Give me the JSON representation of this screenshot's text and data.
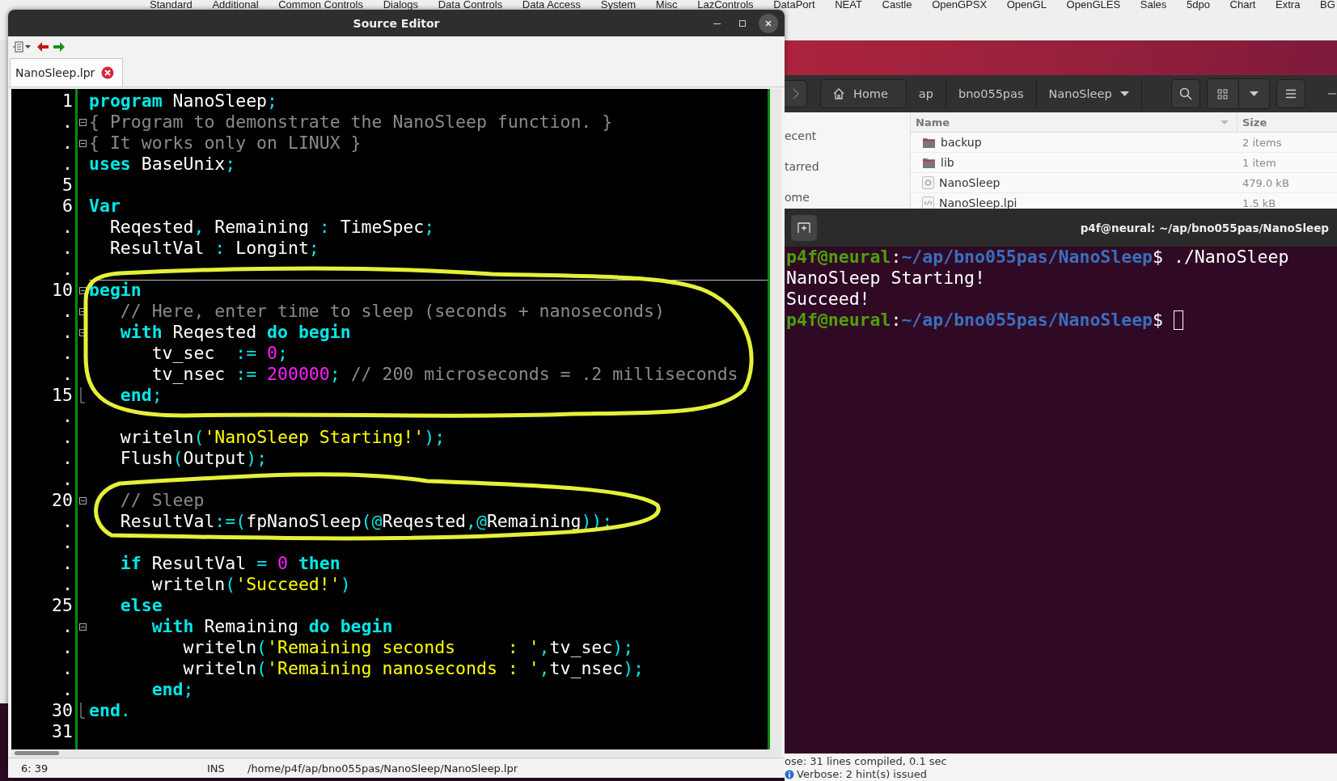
{
  "palette_tabs": [
    "Standard",
    "Additional",
    "Common Controls",
    "Dialogs",
    "Data Controls",
    "Data Access",
    "System",
    "Misc",
    "LazControls",
    "DataPort",
    "NEAT",
    "Castle",
    "OpenGPSX",
    "OpenGL",
    "OpenGLES",
    "Sales",
    "5dpo",
    "Chart",
    "Extra",
    "BG"
  ],
  "source_editor": {
    "title": "Source Editor",
    "tabs": [
      {
        "label": "NanoSleep.lpr",
        "selected": true
      }
    ],
    "lines": [
      {
        "number": "1",
        "tokens": [
          {
            "kind": "kw",
            "text": "program"
          },
          {
            "kind": "id",
            "text": " NanoSleep"
          },
          {
            "kind": "sym",
            "text": ";"
          }
        ]
      },
      {
        "number": ".",
        "foldable": true,
        "tokens": [
          {
            "kind": "com",
            "text": "{ Program to demonstrate the NanoSleep function. }"
          }
        ]
      },
      {
        "number": ".",
        "foldable": true,
        "tokens": [
          {
            "kind": "com",
            "text": "{ It works only on LINUX }"
          }
        ]
      },
      {
        "number": ".",
        "tokens": [
          {
            "kind": "kw",
            "text": "uses"
          },
          {
            "kind": "id",
            "text": " BaseUnix"
          },
          {
            "kind": "sym",
            "text": ";"
          }
        ]
      },
      {
        "number": "5"
      },
      {
        "number": "6",
        "tokens": [
          {
            "kind": "kw",
            "text": "Var"
          }
        ]
      },
      {
        "number": ".",
        "tokens": [
          {
            "kind": "id",
            "text": "  Reqested"
          },
          {
            "kind": "sym",
            "text": ","
          },
          {
            "kind": "id",
            "text": " Remaining "
          },
          {
            "kind": "sym",
            "text": ":"
          },
          {
            "kind": "id",
            "text": " TimeSpec"
          },
          {
            "kind": "sym",
            "text": ";"
          }
        ]
      },
      {
        "number": ".",
        "tokens": [
          {
            "kind": "id",
            "text": "  ResultVal "
          },
          {
            "kind": "sym",
            "text": ":"
          },
          {
            "kind": "id",
            "text": " Longint"
          },
          {
            "kind": "sym",
            "text": ";"
          }
        ]
      },
      {
        "number": "."
      },
      {
        "number": "10",
        "foldable": true,
        "divider_above": true,
        "tokens": [
          {
            "kind": "kw",
            "text": "begin"
          }
        ]
      },
      {
        "number": ".",
        "foldable": true,
        "tokens": [
          {
            "kind": "com",
            "text": "   // Here, enter time to sleep (seconds + nanoseconds)"
          }
        ]
      },
      {
        "number": ".",
        "foldable": true,
        "tokens": [
          {
            "kind": "kw",
            "text": "   with"
          },
          {
            "kind": "id",
            "text": " Reqested "
          },
          {
            "kind": "kw",
            "text": "do begin"
          }
        ]
      },
      {
        "number": ".",
        "tokens": [
          {
            "kind": "id",
            "text": "      tv_sec  "
          },
          {
            "kind": "sym",
            "text": ":= "
          },
          {
            "kind": "num",
            "text": "0"
          },
          {
            "kind": "sym",
            "text": ";"
          }
        ]
      },
      {
        "number": ".",
        "tokens": [
          {
            "kind": "id",
            "text": "      tv_nsec "
          },
          {
            "kind": "sym",
            "text": ":= "
          },
          {
            "kind": "num",
            "text": "200000"
          },
          {
            "kind": "sym",
            "text": ";"
          },
          {
            "kind": "com",
            "text": " // 200 microseconds = .2 milliseconds"
          }
        ]
      },
      {
        "number": "15",
        "fold_end": true,
        "tokens": [
          {
            "kind": "kw",
            "text": "   end"
          },
          {
            "kind": "sym",
            "text": ";"
          }
        ]
      },
      {
        "number": "."
      },
      {
        "number": ".",
        "tokens": [
          {
            "kind": "id",
            "text": "   writeln"
          },
          {
            "kind": "sym",
            "text": "("
          },
          {
            "kind": "str",
            "text": "'NanoSleep Starting!'"
          },
          {
            "kind": "sym",
            "text": ");"
          }
        ]
      },
      {
        "number": ".",
        "tokens": [
          {
            "kind": "id",
            "text": "   Flush"
          },
          {
            "kind": "sym",
            "text": "("
          },
          {
            "kind": "id",
            "text": "Output"
          },
          {
            "kind": "sym",
            "text": ");"
          }
        ]
      },
      {
        "number": "."
      },
      {
        "number": "20",
        "foldable": true,
        "tokens": [
          {
            "kind": "com",
            "text": "   // Sleep"
          }
        ]
      },
      {
        "number": ".",
        "tokens": [
          {
            "kind": "id",
            "text": "   ResultVal"
          },
          {
            "kind": "sym",
            "text": ":=("
          },
          {
            "kind": "id",
            "text": "fpNanoSleep"
          },
          {
            "kind": "sym",
            "text": "(@"
          },
          {
            "kind": "id",
            "text": "Reqested"
          },
          {
            "kind": "sym",
            "text": ",@"
          },
          {
            "kind": "id",
            "text": "Remaining"
          },
          {
            "kind": "sym",
            "text": "));"
          }
        ]
      },
      {
        "number": "."
      },
      {
        "number": ".",
        "tokens": [
          {
            "kind": "kw",
            "text": "   if"
          },
          {
            "kind": "id",
            "text": " ResultVal "
          },
          {
            "kind": "sym",
            "text": "= "
          },
          {
            "kind": "num",
            "text": "0"
          },
          {
            "kind": "kw",
            "text": " then"
          }
        ]
      },
      {
        "number": ".",
        "tokens": [
          {
            "kind": "id",
            "text": "      writeln"
          },
          {
            "kind": "sym",
            "text": "("
          },
          {
            "kind": "str",
            "text": "'Succeed!'"
          },
          {
            "kind": "sym",
            "text": ")"
          }
        ]
      },
      {
        "number": "25",
        "tokens": [
          {
            "kind": "kw",
            "text": "   else"
          }
        ]
      },
      {
        "number": ".",
        "foldable": true,
        "tokens": [
          {
            "kind": "kw",
            "text": "      with"
          },
          {
            "kind": "id",
            "text": " Remaining "
          },
          {
            "kind": "kw",
            "text": "do begin"
          }
        ]
      },
      {
        "number": ".",
        "tokens": [
          {
            "kind": "id",
            "text": "         writeln"
          },
          {
            "kind": "sym",
            "text": "("
          },
          {
            "kind": "str",
            "text": "'Remaining seconds     : '"
          },
          {
            "kind": "sym",
            "text": ","
          },
          {
            "kind": "id",
            "text": "tv_sec"
          },
          {
            "kind": "sym",
            "text": ");"
          }
        ]
      },
      {
        "number": ".",
        "tokens": [
          {
            "kind": "id",
            "text": "         writeln"
          },
          {
            "kind": "sym",
            "text": "("
          },
          {
            "kind": "str",
            "text": "'Remaining nanoseconds : '"
          },
          {
            "kind": "sym",
            "text": ","
          },
          {
            "kind": "id",
            "text": "tv_nsec"
          },
          {
            "kind": "sym",
            "text": ");"
          }
        ]
      },
      {
        "number": ".",
        "tokens": [
          {
            "kind": "kw",
            "text": "      end"
          },
          {
            "kind": "sym",
            "text": ";"
          }
        ]
      },
      {
        "number": "30",
        "fold_end": true,
        "tokens": [
          {
            "kind": "kw",
            "text": "end"
          },
          {
            "kind": "sym",
            "text": "."
          }
        ]
      },
      {
        "number": "31"
      }
    ],
    "annotations": [
      {
        "kind": "loop"
      },
      {
        "kind": "loop"
      }
    ],
    "status_bar": {
      "position": "6: 39",
      "mode": "INS",
      "path": "/home/p4f/ap/bno055pas/NanoSleep/NanoSleep.lpr"
    }
  },
  "file_manager": {
    "path": [
      {
        "label": "Home",
        "kind": "home"
      },
      {
        "label": "ap",
        "kind": "folder"
      },
      {
        "label": "bno055pas",
        "kind": "folder"
      },
      {
        "label": "NanoSleep",
        "kind": "current"
      }
    ],
    "sidebar": [
      "ecent",
      "tarred",
      "ome"
    ],
    "columns": [
      "Name",
      "Size"
    ],
    "rows": [
      {
        "name": "backup",
        "size": "2 items",
        "kind": "folder"
      },
      {
        "name": "lib",
        "size": "1 item",
        "kind": "folder"
      },
      {
        "name": "NanoSleep",
        "size": "479.0 kB",
        "kind": "executable"
      },
      {
        "name": "NanoSleep.lpi",
        "size": "1.5 kB",
        "kind": "markup"
      }
    ]
  },
  "terminal": {
    "title": "p4f@neural: ~/ap/bno055pas/NanoSleep",
    "lines": [
      {
        "tokens": [
          {
            "kind": "user",
            "text": "p4f@neural"
          },
          {
            "kind": "plain",
            "text": ":"
          },
          {
            "kind": "path",
            "text": "~/ap/bno055pas/NanoSleep"
          },
          {
            "kind": "plain",
            "text": "$ ./NanoSleep"
          }
        ]
      },
      {
        "tokens": [
          {
            "kind": "plain",
            "text": "NanoSleep Starting!"
          }
        ]
      },
      {
        "tokens": [
          {
            "kind": "plain",
            "text": "Succeed!"
          }
        ]
      },
      {
        "cursor": true,
        "tokens": [
          {
            "kind": "user",
            "text": "p4f@neural"
          },
          {
            "kind": "plain",
            "text": ":"
          },
          {
            "kind": "path",
            "text": "~/ap/bno055pas/NanoSleep"
          },
          {
            "kind": "plain",
            "text": "$ "
          }
        ]
      }
    ]
  },
  "messages": [
    {
      "kind": "plain",
      "text": "ose: 31 lines compiled, 0.1 sec"
    },
    {
      "kind": "info",
      "text": "Verbose: 2 hint(s) issued"
    }
  ]
}
